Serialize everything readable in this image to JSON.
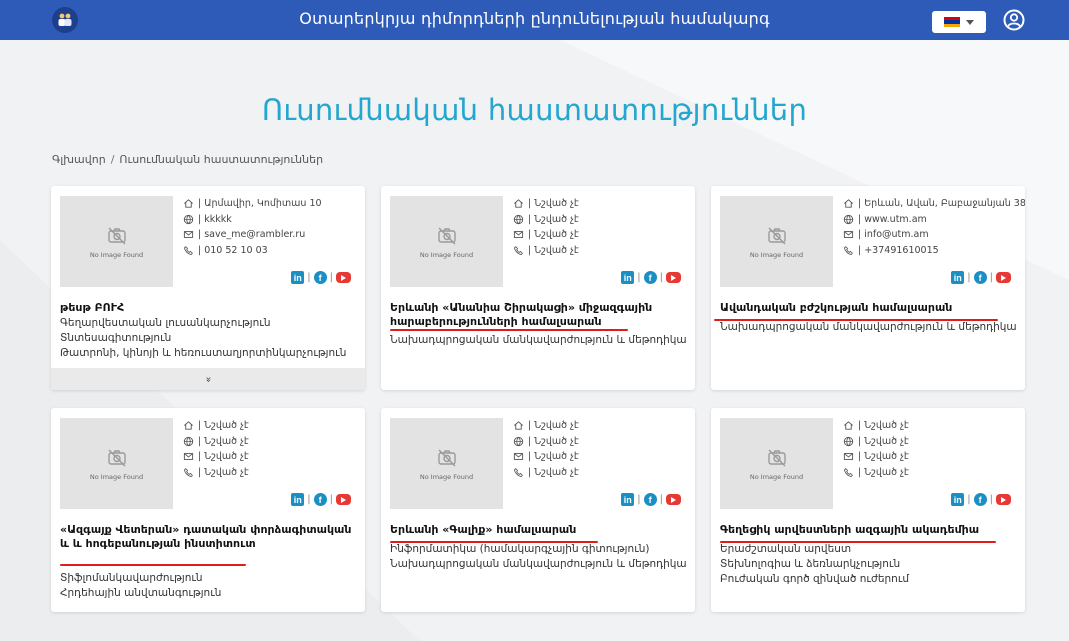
{
  "header": {
    "app_title": "Օտարերկրյա դիմորդների ընդունելության համակարգ",
    "flag_colors": [
      "#d90012",
      "#0033a0",
      "#f2a800"
    ]
  },
  "page": {
    "title": "Ուսումնական հաստատություններ",
    "breadcrumb": {
      "home": "Գլխավոր",
      "separator": "/",
      "current": "Ուսումնական հաստատություններ"
    }
  },
  "no_image_label": "No Image Found",
  "cards": [
    {
      "address": "| Արմավիր, Կոմիտաս 10",
      "website": "| kkkkk",
      "email": "| save_me@rambler.ru",
      "phone": "| 010 52 10 03",
      "name": "թեսթ ԲՈՒՀ",
      "categories": [
        "Գեղարվեստական լուսանկարչություն",
        "Տնտեսագիտություն",
        "Թատրոնի, կինոյի և հեռուստաղյորտինկարչություն"
      ]
    },
    {
      "address": "| Նշված չէ",
      "website": "| Նշված չէ",
      "email": "| Նշված չէ",
      "phone": "| Նշված չէ",
      "name": "Երևանի «Անանիա Շիրակացի» միջազգային հարաբերությունների համալսարան",
      "categories": [
        "Նախադպրոցական մանկավարժություն և մեթոդիկա"
      ]
    },
    {
      "address": "| Երևան, Ավան, Բաբաջանյան 38",
      "website": "| www.utm.am",
      "email": "| info@utm.am",
      "phone": "| +37491610015",
      "name": "Ավանդական բժշկության համալսարան",
      "categories": [
        "Նախադպրոցական մանկավարժություն և մեթոդիկա"
      ]
    },
    {
      "address": "| Նշված չէ",
      "website": "| Նշված չէ",
      "email": "| Նշված չէ",
      "phone": "| Նշված չէ",
      "name": "«Ազգայք Վետերան» դատական փորձագիտական և և հոգեբանության ինստիտուտ",
      "categories": [
        "Տիֆլոմանկավարժություն",
        "Հրդեհային անվտանգություն"
      ]
    },
    {
      "address": "| Նշված չէ",
      "website": "| Նշված չէ",
      "email": "| Նշված չէ",
      "phone": "| Նշված չէ",
      "name": "Երևանի «Գալիք» համալսարան",
      "categories": [
        "Ինֆորմատիկա (համակարգչային գիտություն)",
        "Նախադպրոցական մանկավարժություն և մեթոդիկա"
      ]
    },
    {
      "address": "| Նշված չէ",
      "website": "| Նշված չէ",
      "email": "| Նշված չէ",
      "phone": "| Նշված չէ",
      "name": "Գեղեցիկ արվեստների ազգային ակադեմիա",
      "categories": [
        "Երաժշտական արվեստ",
        "Տեխնոլոգիա և ձեռնարկչություն",
        "Բուժական գործ զինված ուժերում"
      ]
    }
  ]
}
